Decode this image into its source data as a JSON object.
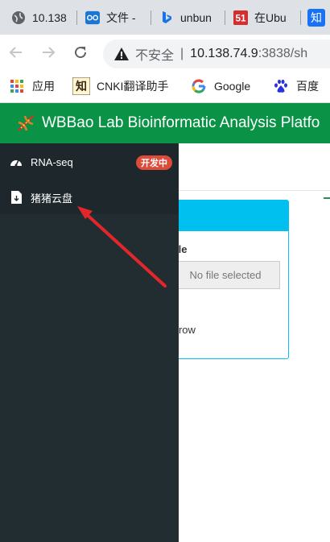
{
  "browser": {
    "tabs": [
      {
        "label": "10.138",
        "icon": "globe-icon"
      },
      {
        "label": "文件 -",
        "icon": "nextcloud-icon"
      },
      {
        "label": "unbun",
        "icon": "bing-icon"
      },
      {
        "label": "在Ubu",
        "icon": "51cto-icon"
      },
      {
        "label": "知",
        "icon": "zhihu-icon"
      }
    ],
    "address": {
      "insecure_label": "不安全",
      "separator": "|",
      "host": "10.138.74.9",
      "rest": ":3838/sh"
    },
    "bookmarks": [
      {
        "label": "应用",
        "icon": "apps-grid-icon"
      },
      {
        "label": "CNKI翻译助手",
        "icon": "cnki-icon"
      },
      {
        "label": "Google",
        "icon": "google-icon"
      },
      {
        "label": "百度",
        "icon": "baidu-icon"
      }
    ]
  },
  "app": {
    "title": "WBBao Lab Bioinformatic Analysis Platfo",
    "header_color": "#0a9346",
    "sidebar": {
      "items": [
        {
          "label": "RNA-seq",
          "icon": "dashboard-icon",
          "badge": "开发中",
          "badge_color": "#dd4b39"
        },
        {
          "label": "猪猪云盘",
          "icon": "file-icon"
        }
      ]
    },
    "main": {
      "box_accent": "#00c0ef",
      "file_label": "ile",
      "file_placeholder": "No file selected",
      "row_text": "r row"
    }
  }
}
